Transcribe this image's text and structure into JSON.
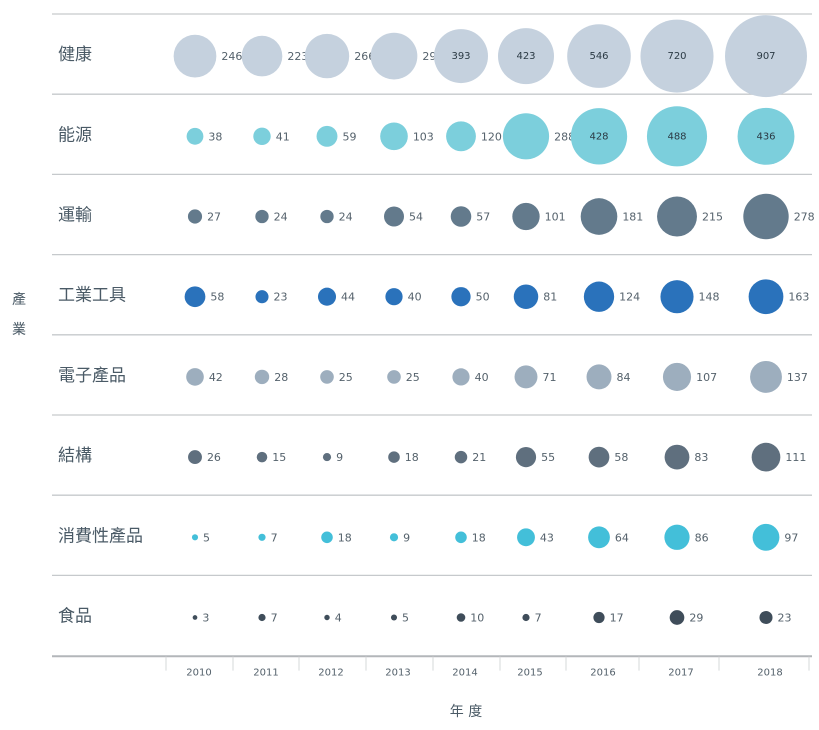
{
  "chart_data": {
    "type": "bubble",
    "xlabel": "年 度",
    "ylabel": "產業",
    "years": [
      "2010",
      "2011",
      "2012",
      "2013",
      "2014",
      "2015",
      "2016",
      "2017",
      "2018"
    ],
    "series": [
      {
        "name": "健康",
        "color": "#c5d1de",
        "values": [
          246,
          223,
          266,
          294,
          393,
          423,
          546,
          720,
          907
        ]
      },
      {
        "name": "能源",
        "color": "#7ccfdc",
        "values": [
          38,
          41,
          59,
          103,
          120,
          288,
          428,
          488,
          436
        ]
      },
      {
        "name": "運輸",
        "color": "#637a8c",
        "values": [
          27,
          24,
          24,
          54,
          57,
          101,
          181,
          215,
          278
        ]
      },
      {
        "name": "工業工具",
        "color": "#2a72bb",
        "values": [
          58,
          23,
          44,
          40,
          50,
          81,
          124,
          148,
          163
        ]
      },
      {
        "name": "電子產品",
        "color": "#9daebe",
        "values": [
          42,
          28,
          25,
          25,
          40,
          71,
          84,
          107,
          137
        ]
      },
      {
        "name": "結構",
        "color": "#5f6f7e",
        "values": [
          26,
          15,
          9,
          18,
          21,
          55,
          58,
          83,
          111
        ]
      },
      {
        "name": "消費性產品",
        "color": "#43bfd9",
        "values": [
          5,
          7,
          18,
          9,
          18,
          43,
          64,
          86,
          97
        ]
      },
      {
        "name": "食品",
        "color": "#3f4d5a",
        "values": [
          3,
          7,
          4,
          5,
          10,
          7,
          17,
          29,
          23
        ]
      }
    ]
  }
}
